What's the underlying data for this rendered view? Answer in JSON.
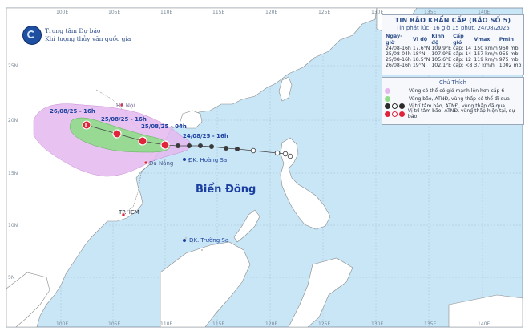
{
  "bulletin": {
    "title": "TIN BÃO KHẨN CẤP (BÃO SỐ 5)",
    "issued": "Tin phát lúc: 16 giờ 15 phút, 24/08/2025",
    "columns": [
      "Ngày-giờ",
      "Vĩ độ",
      "Kinh độ",
      "Cấp gió",
      "Vmax",
      "Pmin"
    ],
    "rows": [
      [
        "24/08-16h",
        "17.6°N",
        "109.9°E",
        "cấp: 14",
        "150 km/h",
        "960 mb"
      ],
      [
        "25/08-04h",
        "18°N",
        "107.9°E",
        "cấp: 14",
        "157 km/h",
        "955 mb"
      ],
      [
        "25/08-16h",
        "18.5°N",
        "105.6°E",
        "cấp: 12",
        "119 km/h",
        "975 mb"
      ],
      [
        "26/08-16h",
        "19°N",
        "102.1°E",
        "cấp: <8",
        "37 km/h",
        "1002 mb"
      ]
    ]
  },
  "agency": {
    "line1": "Trung tâm Dự báo",
    "line2": "Khí tượng thủy văn quốc gia"
  },
  "legend": {
    "title": "Chú Thích",
    "items": [
      "Vùng có thể có gió mạnh lên hơn cấp 6",
      "Vùng bão, ATNĐ, vùng thấp có thể đi qua",
      "Vị trí tâm bão, ATNĐ, vùng thấp đã qua",
      "Vị trí tâm bão, ATNĐ, vùng thấp hiện tại, dự báo"
    ]
  },
  "map_labels": {
    "sea": "Biển Đông",
    "hanoi": "Hà Nội",
    "danang": "Đà Nẵng",
    "hoangsa": "ĐK. Hoàng Sa",
    "hcm": "TP.HCM",
    "truongsa": "ĐK. Trường Sa"
  },
  "forecast_labels": {
    "t0": "24/08/25 - 16h",
    "t1": "25/08/25 - 04h",
    "t2": "25/08/25 - 16h",
    "t3": "26/08/25 - 16h"
  },
  "grid": {
    "lon_ticks": [
      "100E",
      "105E",
      "110E",
      "115E",
      "120E",
      "125E",
      "130E",
      "135E",
      "140E"
    ],
    "lat_ticks": [
      "25N",
      "20N",
      "15N",
      "10N",
      "5N"
    ]
  },
  "colors": {
    "sea": "#c9e6f7",
    "land": "#ffffff",
    "purple_zone": "#e4b8ee",
    "green_zone": "#8fdc8a",
    "storm_red": "#e0243b",
    "title_blue": "#2f4f8a"
  }
}
